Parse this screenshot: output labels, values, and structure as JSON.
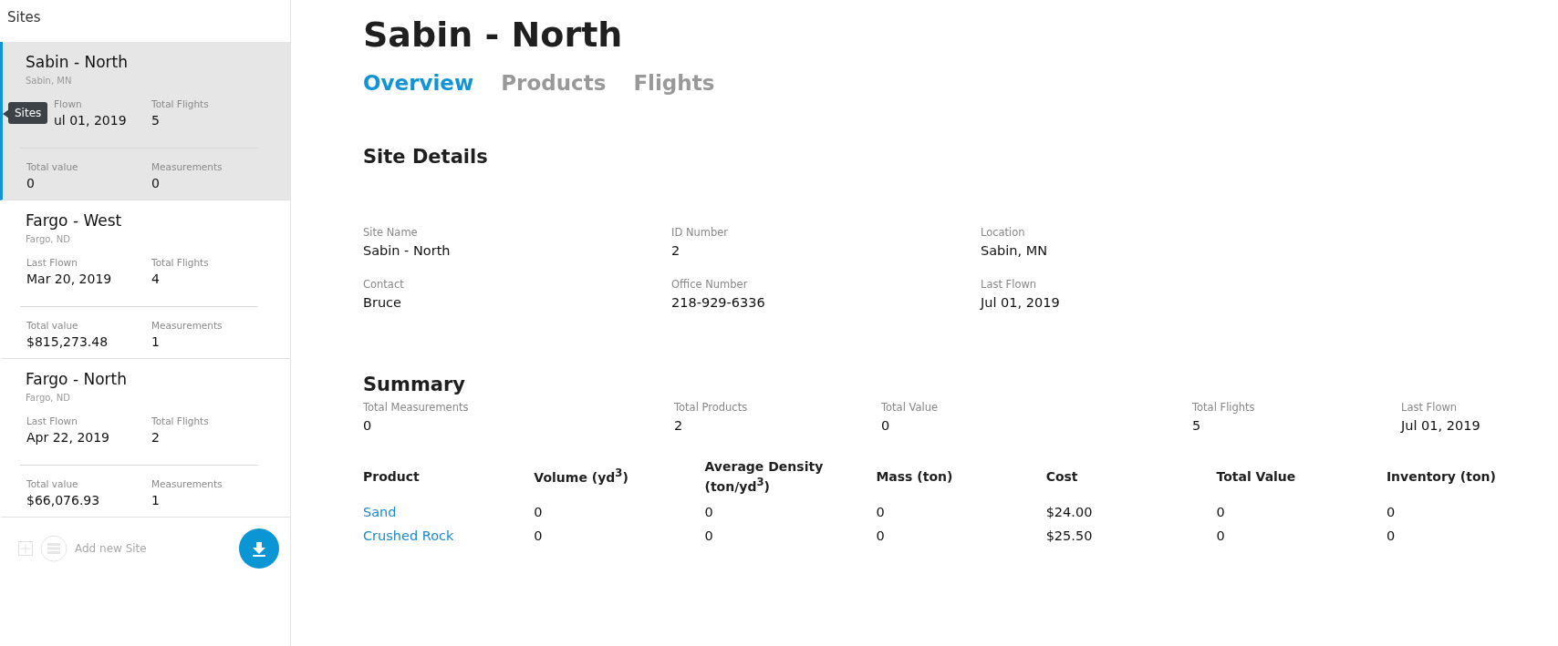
{
  "sidebar": {
    "title": "Sites",
    "tooltip": "Sites",
    "sites": [
      {
        "name": "Sabin - North",
        "location": "Sabin, MN",
        "selected": true,
        "tooltip_over": true,
        "stats": [
          {
            "label": "Flown",
            "value": "ul 01, 2019"
          },
          {
            "label": "Total Flights",
            "value": "5"
          },
          {
            "label": "Total value",
            "value": "0"
          },
          {
            "label": "Measurements",
            "value": "0"
          }
        ]
      },
      {
        "name": "Fargo - West",
        "location": "Fargo, ND",
        "selected": false,
        "tooltip_over": false,
        "stats": [
          {
            "label": "Last Flown",
            "value": "Mar 20, 2019"
          },
          {
            "label": "Total Flights",
            "value": "4"
          },
          {
            "label": "Total value",
            "value": "$815,273.48"
          },
          {
            "label": "Measurements",
            "value": "1"
          }
        ]
      },
      {
        "name": "Fargo - North",
        "location": "Fargo, ND",
        "selected": false,
        "tooltip_over": false,
        "stats": [
          {
            "label": "Last Flown",
            "value": "Apr 22, 2019"
          },
          {
            "label": "Total Flights",
            "value": "2"
          },
          {
            "label": "Total value",
            "value": "$66,076.93"
          },
          {
            "label": "Measurements",
            "value": "1"
          }
        ]
      }
    ],
    "add_label": "Add new Site"
  },
  "title": "Sabin - North",
  "tabs": [
    {
      "label": "Overview",
      "selected": true
    },
    {
      "label": "Products",
      "selected": false
    },
    {
      "label": "Flights",
      "selected": false
    }
  ],
  "site_details": {
    "heading": "Site Details",
    "fields": [
      {
        "label": "Site Name",
        "value": "Sabin - North"
      },
      {
        "label": "ID Number",
        "value": "2"
      },
      {
        "label": "Location",
        "value": "Sabin, MN"
      },
      {
        "label": "Contact",
        "value": "Bruce"
      },
      {
        "label": "Office Number",
        "value": "218-929-6336"
      },
      {
        "label": "Last Flown",
        "value": "Jul 01, 2019"
      }
    ]
  },
  "summary": {
    "heading": "Summary",
    "stats": [
      {
        "label": "Total Measurements",
        "value": "0"
      },
      {
        "label": "Total Products",
        "value": "2"
      },
      {
        "label": "Total Value",
        "value": "0"
      },
      {
        "label": "Total Flights",
        "value": "5"
      },
      {
        "label": "Last Flown",
        "value": "Jul 01, 2019"
      }
    ]
  },
  "table": {
    "columns": [
      "Product",
      "Volume (yd$^{3}$)",
      "Average Density (ton/yd$^{3}$)",
      "Mass (ton)",
      "Cost",
      "Total Value",
      "Inventory (ton)"
    ],
    "rows": [
      [
        "Sand",
        "0",
        "0",
        "0",
        "$24.00",
        "0",
        "0"
      ],
      [
        "Crushed Rock",
        "0",
        "0",
        "0",
        "$25.50",
        "0",
        "0"
      ]
    ]
  }
}
